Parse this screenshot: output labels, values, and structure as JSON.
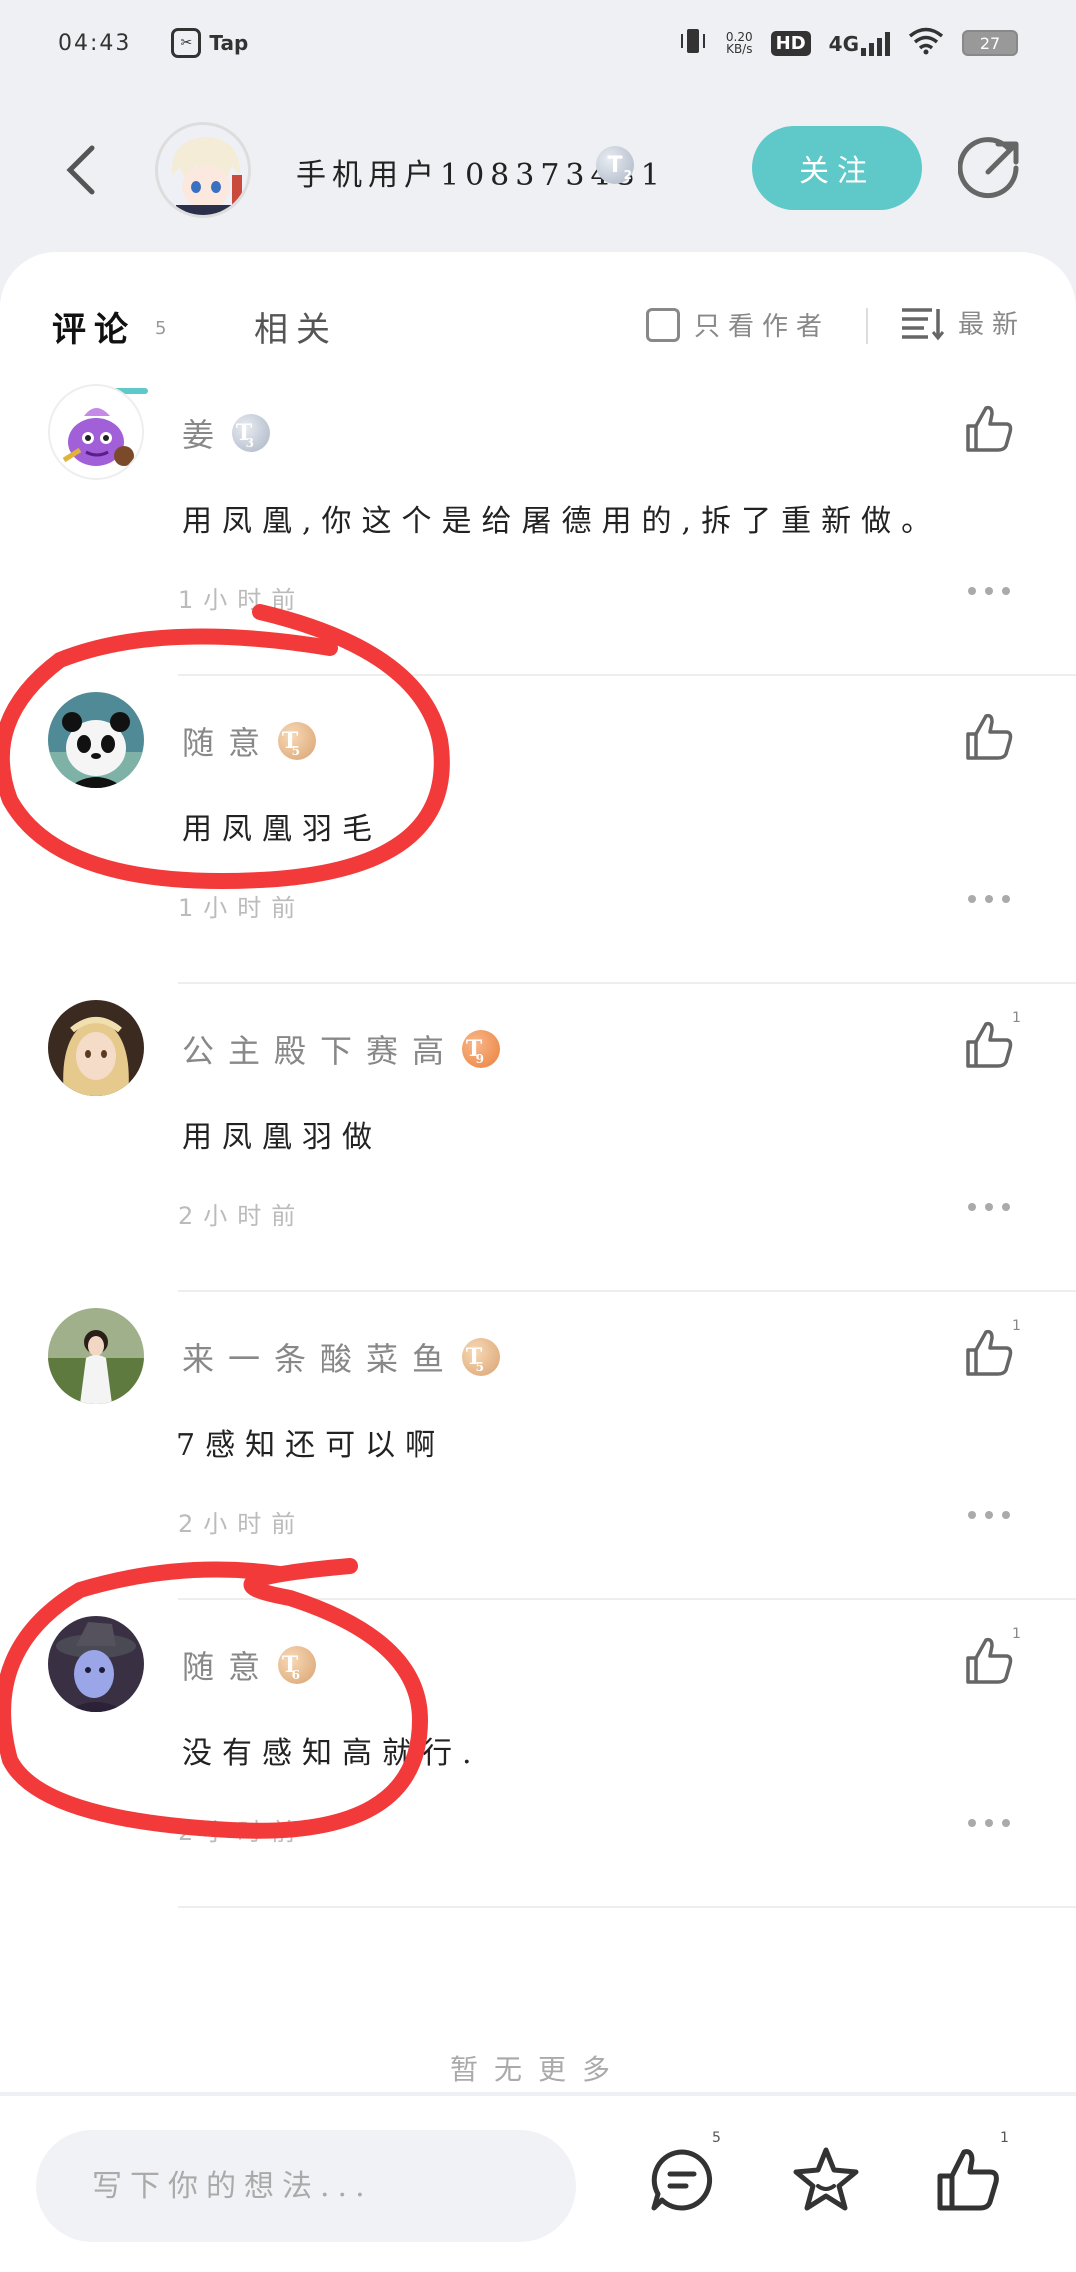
{
  "status_bar": {
    "time": "04:43",
    "app_name": "Tap",
    "net_speed_value": "0.20",
    "net_speed_unit": "KB/s",
    "hd_label": "HD",
    "network_label": "4G",
    "battery": "27"
  },
  "header": {
    "username": "手机用户108373431",
    "level": "T",
    "level_num": "2",
    "follow_label": "关注"
  },
  "tabs": {
    "comments_label": "评论",
    "comments_count": "5",
    "related_label": "相关",
    "author_only_label": "只看作者",
    "sort_label": "最新"
  },
  "comments": [
    {
      "name": "姜",
      "level": "T",
      "level_num": "3",
      "badge_color": "silver",
      "text": "用凤凰,你这个是给屠德用的,拆了重新做。",
      "time": "1小时前",
      "likes": ""
    },
    {
      "name": "随意",
      "level": "T",
      "level_num": "5",
      "badge_color": "gold",
      "text": "用凤凰羽毛",
      "time": "1小时前",
      "likes": ""
    },
    {
      "name": "公主殿下赛高",
      "level": "T",
      "level_num": "9",
      "badge_color": "orange",
      "text": "用凤凰羽做",
      "time": "2小时前",
      "likes": "1"
    },
    {
      "name": "来一条酸菜鱼",
      "level": "T",
      "level_num": "5",
      "badge_color": "gold",
      "text": "7感知还可以啊",
      "time": "2小时前",
      "likes": "1"
    },
    {
      "name": "随意",
      "level": "T",
      "level_num": "6",
      "badge_color": "gold",
      "text": "没有感知高就行.",
      "time": "2小时前",
      "likes": "1"
    }
  ],
  "footer": {
    "no_more": "暂无更多",
    "input_placeholder": "写下你的想法...",
    "comment_count": "5",
    "like_count": "1"
  }
}
